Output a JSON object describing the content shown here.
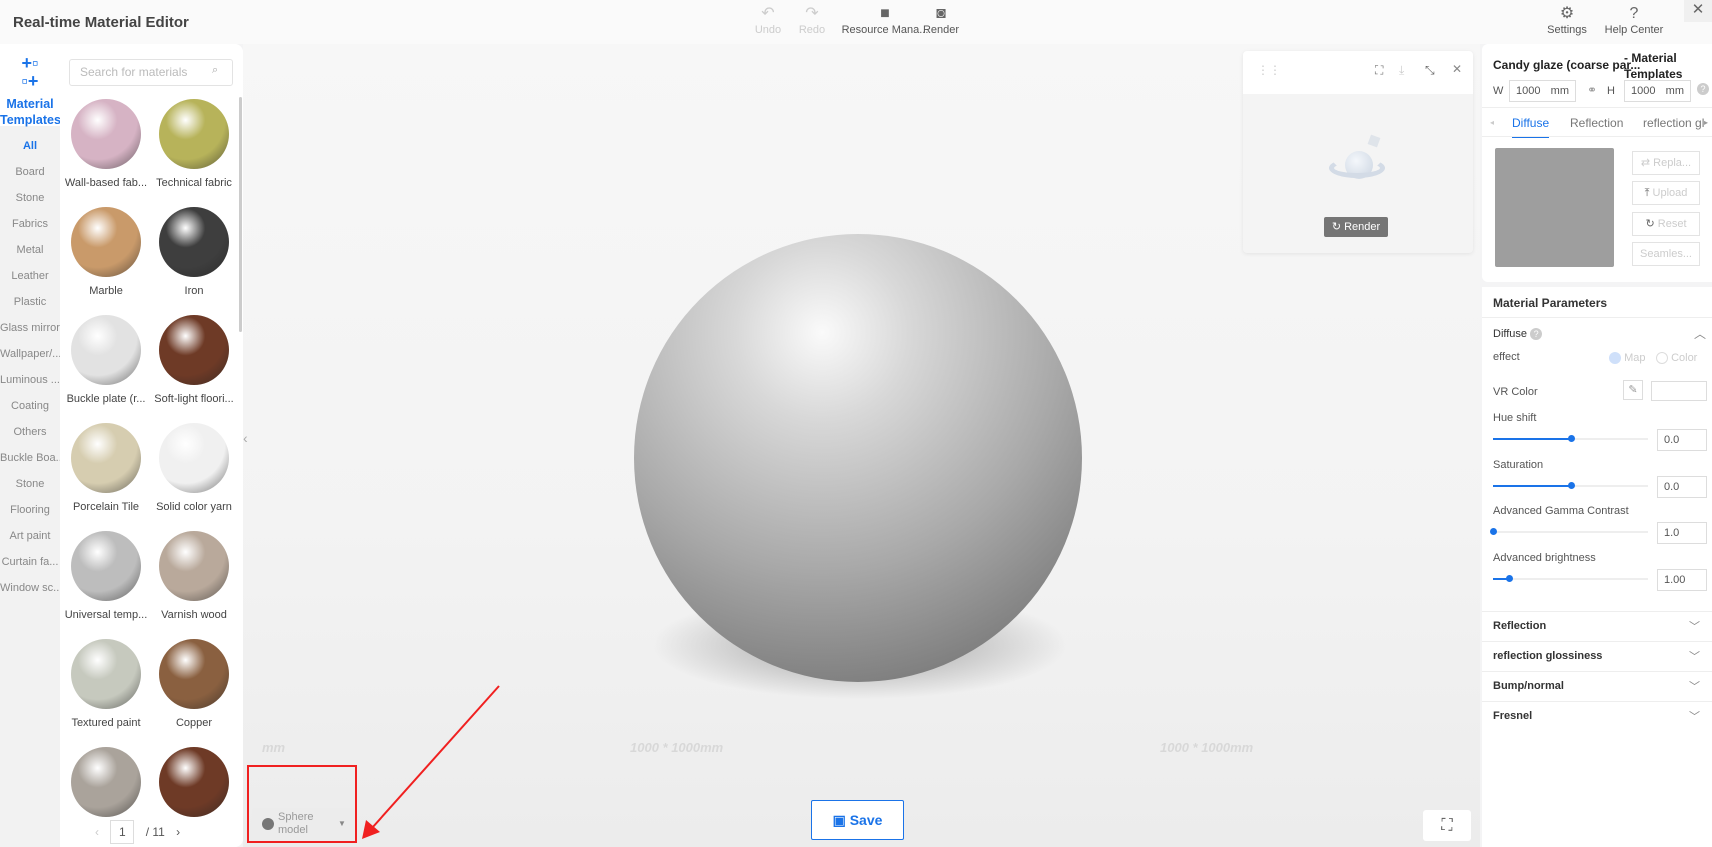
{
  "app": {
    "title": "Real-time Material Editor"
  },
  "toolbar": {
    "undo": "Undo",
    "redo": "Redo",
    "resource": "Resource Mana...",
    "render": "Render",
    "settings": "Settings",
    "help": "Help Center"
  },
  "sidebar": {
    "header": "Material Templates",
    "categories": [
      "All",
      "Board",
      "Stone",
      "Fabrics",
      "Metal",
      "Leather",
      "Plastic",
      "Glass mirror",
      "Wallpaper/...",
      "Luminous ...",
      "Coating",
      "Others",
      "Buckle Boa...",
      "Stone",
      "Flooring",
      "Art paint",
      "Curtain fa...",
      "Window sc..."
    ]
  },
  "materials": {
    "search_placeholder": "Search for materials",
    "items": [
      {
        "name": "Wall-based fab...",
        "color": "#d6b3c4"
      },
      {
        "name": "Technical fabric",
        "color": "#b7b35a"
      },
      {
        "name": "Marble",
        "color": "#c99a6a"
      },
      {
        "name": "Iron",
        "color": "#3e3e3e"
      },
      {
        "name": "Buckle plate (r...",
        "color": "#e2e2e2"
      },
      {
        "name": "Soft-light floori...",
        "color": "#6e3a26"
      },
      {
        "name": "Porcelain Tile",
        "color": "#d6cdb0"
      },
      {
        "name": "Solid color yarn",
        "color": "#f0f0f0"
      },
      {
        "name": "Universal temp...",
        "color": "#bdbdbd"
      },
      {
        "name": "Varnish wood",
        "color": "#b9a99b"
      },
      {
        "name": "Textured paint",
        "color": "#c6c9be"
      },
      {
        "name": "Copper",
        "color": "#8a6040"
      },
      {
        "name": "",
        "color": "#aaa39b"
      },
      {
        "name": "",
        "color": "#6e3a26"
      }
    ],
    "page": "1",
    "total_pages": "/ 11"
  },
  "viewport": {
    "floor_label": "1000 * 1000mm",
    "floor_label_left": "mm",
    "preview_render": "Render",
    "save": "Save",
    "model": "Sphere model"
  },
  "right": {
    "title": "Candy glaze (coarse par...",
    "subtitle": "- Material Templates",
    "w_label": "W",
    "h_label": "H",
    "w": "1000",
    "h": "1000",
    "unit": "mm",
    "tabs": [
      "Diffuse",
      "Reflection",
      "reflection gl"
    ],
    "buttons": [
      "Repla...",
      "Upload",
      "Reset",
      "Seamles..."
    ],
    "params_title": "Material Parameters",
    "diffuse": "Diffuse",
    "effect": "effect",
    "map": "Map",
    "color": "Color",
    "vr_color": "VR Color",
    "sliders": [
      {
        "label": "Hue shift",
        "value": "0.0",
        "fraction": 0.5
      },
      {
        "label": "Saturation",
        "value": "0.0",
        "fraction": 0.5
      },
      {
        "label": "Advanced Gamma Contrast",
        "value": "1.0",
        "fraction": 0.0
      },
      {
        "label": "Advanced brightness",
        "value": "1.00",
        "fraction": 0.1
      }
    ],
    "sections": [
      "Reflection",
      "reflection glossiness",
      "Bump/normal",
      "Fresnel"
    ]
  },
  "colors": {
    "accent": "#1a73e8",
    "highlight": "#f02020"
  }
}
